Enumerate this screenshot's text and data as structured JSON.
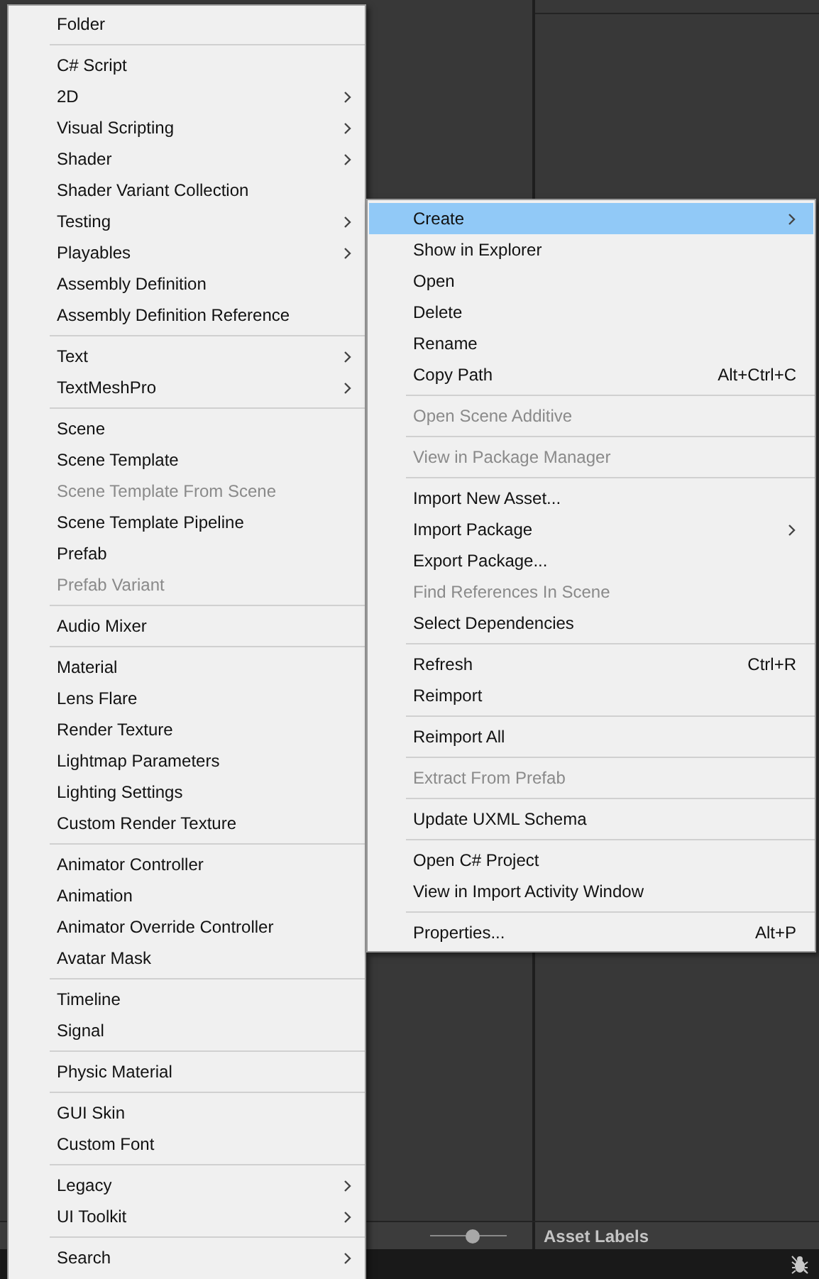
{
  "background": {
    "asset_labels": "Asset Labels",
    "thumbnail_slider": {
      "level": 0.55
    }
  },
  "create_menu": {
    "groups": [
      [
        {
          "label": "Folder",
          "disabled": false,
          "submenu": false
        }
      ],
      [
        {
          "label": "C# Script",
          "disabled": false,
          "submenu": false
        },
        {
          "label": "2D",
          "disabled": false,
          "submenu": true
        },
        {
          "label": "Visual Scripting",
          "disabled": false,
          "submenu": true
        },
        {
          "label": "Shader",
          "disabled": false,
          "submenu": true
        },
        {
          "label": "Shader Variant Collection",
          "disabled": false,
          "submenu": false
        },
        {
          "label": "Testing",
          "disabled": false,
          "submenu": true
        },
        {
          "label": "Playables",
          "disabled": false,
          "submenu": true
        },
        {
          "label": "Assembly Definition",
          "disabled": false,
          "submenu": false
        },
        {
          "label": "Assembly Definition Reference",
          "disabled": false,
          "submenu": false
        }
      ],
      [
        {
          "label": "Text",
          "disabled": false,
          "submenu": true
        },
        {
          "label": "TextMeshPro",
          "disabled": false,
          "submenu": true
        }
      ],
      [
        {
          "label": "Scene",
          "disabled": false,
          "submenu": false
        },
        {
          "label": "Scene Template",
          "disabled": false,
          "submenu": false
        },
        {
          "label": "Scene Template From Scene",
          "disabled": true,
          "submenu": false
        },
        {
          "label": "Scene Template Pipeline",
          "disabled": false,
          "submenu": false
        },
        {
          "label": "Prefab",
          "disabled": false,
          "submenu": false
        },
        {
          "label": "Prefab Variant",
          "disabled": true,
          "submenu": false
        }
      ],
      [
        {
          "label": "Audio Mixer",
          "disabled": false,
          "submenu": false
        }
      ],
      [
        {
          "label": "Material",
          "disabled": false,
          "submenu": false
        },
        {
          "label": "Lens Flare",
          "disabled": false,
          "submenu": false
        },
        {
          "label": "Render Texture",
          "disabled": false,
          "submenu": false
        },
        {
          "label": "Lightmap Parameters",
          "disabled": false,
          "submenu": false
        },
        {
          "label": "Lighting Settings",
          "disabled": false,
          "submenu": false
        },
        {
          "label": "Custom Render Texture",
          "disabled": false,
          "submenu": false
        }
      ],
      [
        {
          "label": "Animator Controller",
          "disabled": false,
          "submenu": false
        },
        {
          "label": "Animation",
          "disabled": false,
          "submenu": false
        },
        {
          "label": "Animator Override Controller",
          "disabled": false,
          "submenu": false
        },
        {
          "label": "Avatar Mask",
          "disabled": false,
          "submenu": false
        }
      ],
      [
        {
          "label": "Timeline",
          "disabled": false,
          "submenu": false
        },
        {
          "label": "Signal",
          "disabled": false,
          "submenu": false
        }
      ],
      [
        {
          "label": "Physic Material",
          "disabled": false,
          "submenu": false
        }
      ],
      [
        {
          "label": "GUI Skin",
          "disabled": false,
          "submenu": false
        },
        {
          "label": "Custom Font",
          "disabled": false,
          "submenu": false
        }
      ],
      [
        {
          "label": "Legacy",
          "disabled": false,
          "submenu": true
        },
        {
          "label": "UI Toolkit",
          "disabled": false,
          "submenu": true
        }
      ],
      [
        {
          "label": "Search",
          "disabled": false,
          "submenu": true
        }
      ]
    ]
  },
  "context_menu": {
    "groups": [
      [
        {
          "label": "Create",
          "disabled": false,
          "submenu": true,
          "selected": true
        },
        {
          "label": "Show in Explorer",
          "disabled": false,
          "submenu": false,
          "selected": false
        },
        {
          "label": "Open",
          "disabled": false,
          "submenu": false,
          "selected": false
        },
        {
          "label": "Delete",
          "disabled": false,
          "submenu": false,
          "selected": false
        },
        {
          "label": "Rename",
          "disabled": false,
          "submenu": false,
          "selected": false
        },
        {
          "label": "Copy Path",
          "shortcut": "Alt+Ctrl+C",
          "disabled": false,
          "submenu": false,
          "selected": false
        }
      ],
      [
        {
          "label": "Open Scene Additive",
          "disabled": true,
          "submenu": false,
          "selected": false
        }
      ],
      [
        {
          "label": "View in Package Manager",
          "disabled": true,
          "submenu": false,
          "selected": false
        }
      ],
      [
        {
          "label": "Import New Asset...",
          "disabled": false,
          "submenu": false,
          "selected": false
        },
        {
          "label": "Import Package",
          "disabled": false,
          "submenu": true,
          "selected": false
        },
        {
          "label": "Export Package...",
          "disabled": false,
          "submenu": false,
          "selected": false
        },
        {
          "label": "Find References In Scene",
          "disabled": true,
          "submenu": false,
          "selected": false
        },
        {
          "label": "Select Dependencies",
          "disabled": false,
          "submenu": false,
          "selected": false
        }
      ],
      [
        {
          "label": "Refresh",
          "shortcut": "Ctrl+R",
          "disabled": false,
          "submenu": false,
          "selected": false
        },
        {
          "label": "Reimport",
          "disabled": false,
          "submenu": false,
          "selected": false
        }
      ],
      [
        {
          "label": "Reimport All",
          "disabled": false,
          "submenu": false,
          "selected": false
        }
      ],
      [
        {
          "label": "Extract From Prefab",
          "disabled": true,
          "submenu": false,
          "selected": false
        }
      ],
      [
        {
          "label": "Update UXML Schema",
          "disabled": false,
          "submenu": false,
          "selected": false
        }
      ],
      [
        {
          "label": "Open C# Project",
          "disabled": false,
          "submenu": false,
          "selected": false
        },
        {
          "label": "View in Import Activity Window",
          "disabled": false,
          "submenu": false,
          "selected": false
        }
      ],
      [
        {
          "label": "Properties...",
          "shortcut": "Alt+P",
          "disabled": false,
          "submenu": false,
          "selected": false
        }
      ]
    ]
  }
}
